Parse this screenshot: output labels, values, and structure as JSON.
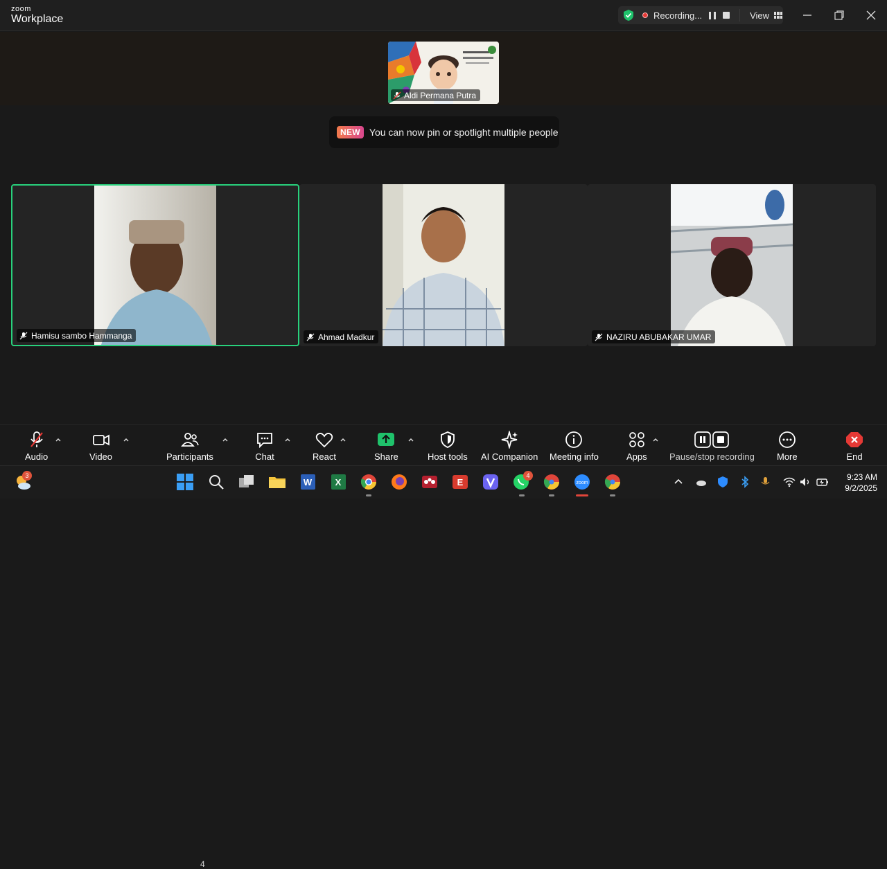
{
  "app": {
    "brand_top": "zoom",
    "brand_bottom": "Workplace"
  },
  "recording": {
    "status": "Recording...",
    "view_label": "View"
  },
  "thumbnail": {
    "name": "Aldi Permana Putra"
  },
  "tooltip": {
    "badge": "NEW",
    "text": "You can now pin or spotlight multiple people"
  },
  "participants": [
    {
      "name": "Hamisu sambo Hammanga",
      "active_speaker": true
    },
    {
      "name": "Ahmad Madkur",
      "active_speaker": false
    },
    {
      "name": "NAZIRU ABUBAKAR UMAR",
      "active_speaker": false
    }
  ],
  "toolbar": {
    "audio": "Audio",
    "video": "Video",
    "participants": "Participants",
    "participants_count": "4",
    "chat": "Chat",
    "react": "React",
    "share": "Share",
    "host_tools": "Host tools",
    "ai_companion": "AI Companion",
    "meeting_info": "Meeting info",
    "apps": "Apps",
    "pause_stop": "Pause/stop recording",
    "more": "More",
    "end": "End"
  },
  "taskbar": {
    "weather_badge": "3",
    "whatsapp_badge": "4",
    "time": "9:23 AM",
    "date": "9/2/2025"
  },
  "colors": {
    "active_border": "#28d17c",
    "share_green": "#1fc26b",
    "end_red": "#e53935",
    "rec_red": "#e53935"
  }
}
